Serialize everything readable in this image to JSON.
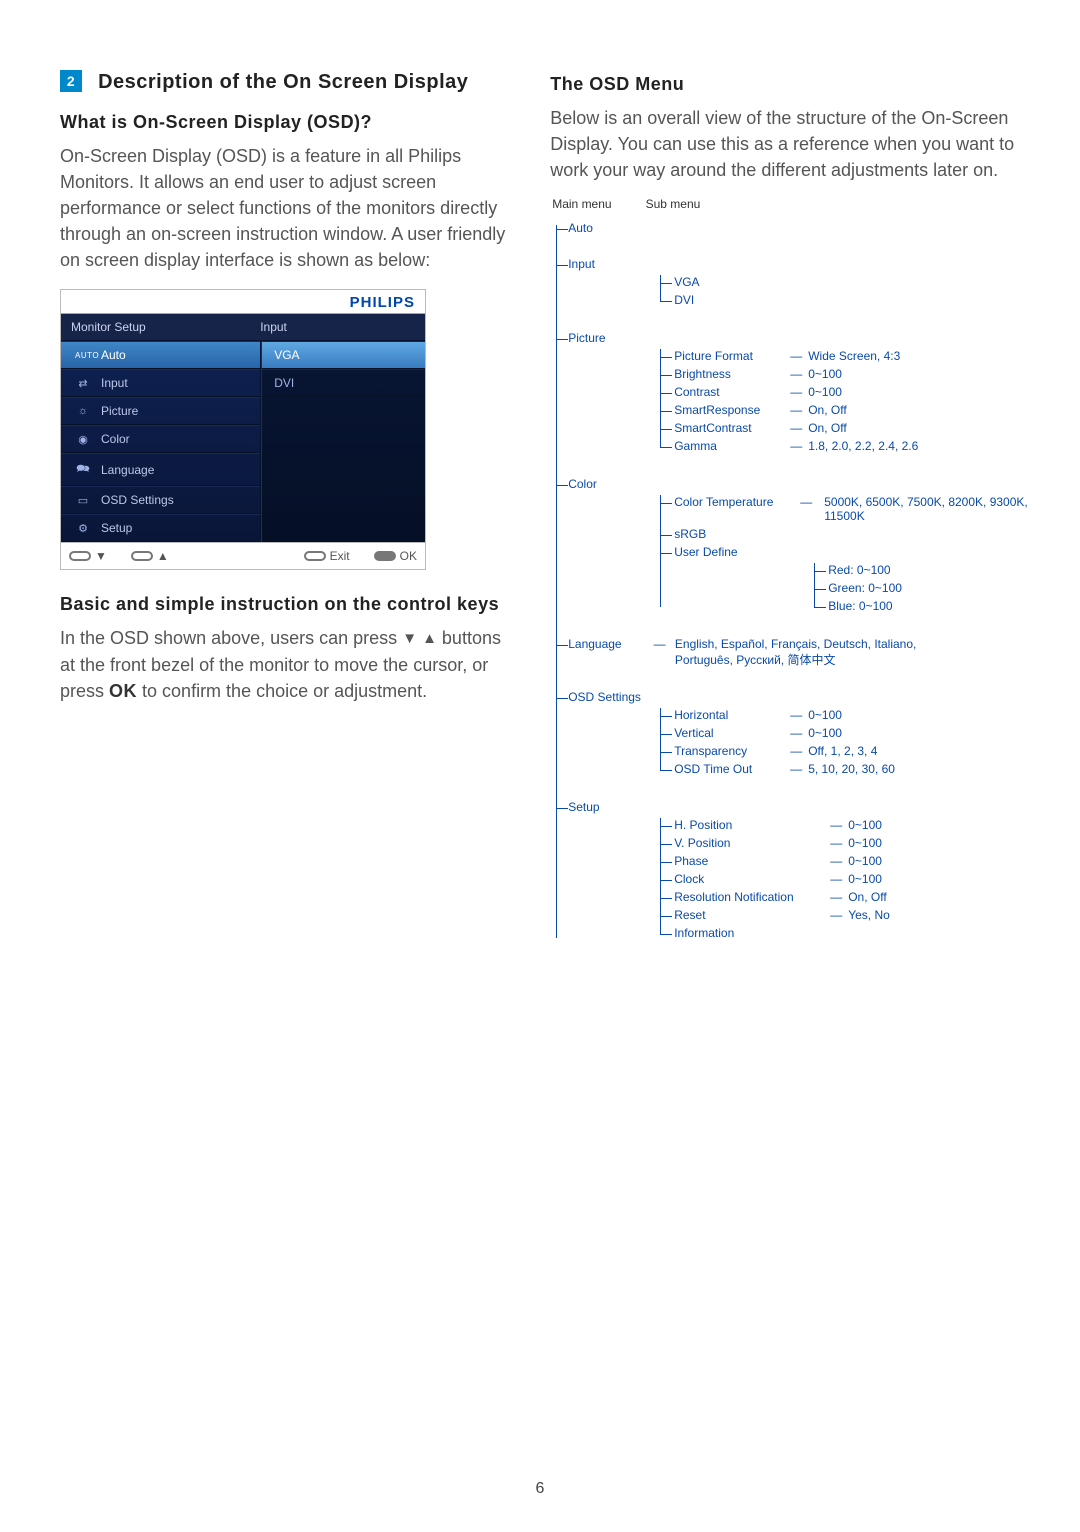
{
  "section": {
    "marker": "2",
    "title": "Description of the On Screen Display"
  },
  "left": {
    "h_whatis": "What is On-Screen Display (OSD)?",
    "p_whatis": "On-Screen Display (OSD) is a feature in all Philips Monitors. It allows an end user to adjust screen performance or select functions of the monitors directly through an on-screen instruction window. A user friendly on screen display interface is shown as below:",
    "h_basic": "Basic and simple instruction on the control keys",
    "p_basic_1": "In the OSD shown above, users can press ",
    "p_basic_2": " buttons at the front bezel of the monitor to move the cursor, or press ",
    "p_basic_ok": "OK",
    "p_basic_3": " to confirm the choice or adjustment."
  },
  "osd": {
    "logo": "PHILIPS",
    "header_left": "Monitor Setup",
    "header_right": "Input",
    "left_items": [
      {
        "icon": "AUTO",
        "label": "Auto",
        "active": true,
        "kind": "auto"
      },
      {
        "icon": "⇄",
        "label": "Input"
      },
      {
        "icon": "☼",
        "label": "Picture"
      },
      {
        "icon": "◉",
        "label": "Color"
      },
      {
        "icon": "🗪",
        "label": "Language"
      },
      {
        "icon": "▭",
        "label": "OSD Settings"
      },
      {
        "icon": "⚙",
        "label": "Setup"
      }
    ],
    "right_items": [
      {
        "label": "VGA",
        "hi": true
      },
      {
        "label": "DVI"
      }
    ],
    "bottom": {
      "down": "▼",
      "up": "▲",
      "exit": "Exit",
      "ok": "OK"
    }
  },
  "right": {
    "h": "The OSD Menu",
    "p": "Below is an overall view of the structure of the On-Screen Display. You can use this as a reference when you want to work your way around the different adjustments later on.",
    "tree_head_main": "Main menu",
    "tree_head_sub": "Sub menu"
  },
  "tree": {
    "auto": "Auto",
    "input": {
      "label": "Input",
      "items": [
        "VGA",
        "DVI"
      ]
    },
    "picture": {
      "label": "Picture",
      "items": [
        {
          "k": "Picture Format",
          "v": "Wide Screen, 4:3"
        },
        {
          "k": "Brightness",
          "v": "0~100"
        },
        {
          "k": "Contrast",
          "v": "0~100"
        },
        {
          "k": "SmartResponse",
          "v": "On, Off"
        },
        {
          "k": "SmartContrast",
          "v": "On, Off"
        },
        {
          "k": "Gamma",
          "v": "1.8, 2.0, 2.2, 2.4, 2.6"
        }
      ]
    },
    "color": {
      "label": "Color",
      "ct_k": "Color Temperature",
      "ct_v": "5000K, 6500K, 7500K, 8200K, 9300K, 11500K",
      "srgb": "sRGB",
      "ud": "User Define",
      "ud_items": [
        "Red: 0~100",
        "Green: 0~100",
        "Blue: 0~100"
      ]
    },
    "language": {
      "label": "Language",
      "value": "English, Español, Français, Deutsch, Italiano, Português, Русский, 简体中文"
    },
    "osd": {
      "label": "OSD Settings",
      "items": [
        {
          "k": "Horizontal",
          "v": "0~100"
        },
        {
          "k": "Vertical",
          "v": "0~100"
        },
        {
          "k": "Transparency",
          "v": "Off, 1, 2, 3, 4"
        },
        {
          "k": "OSD Time Out",
          "v": "5, 10, 20, 30, 60"
        }
      ]
    },
    "setup": {
      "label": "Setup",
      "items": [
        {
          "k": "H. Position",
          "v": "0~100"
        },
        {
          "k": "V. Position",
          "v": "0~100"
        },
        {
          "k": "Phase",
          "v": "0~100"
        },
        {
          "k": "Clock",
          "v": "0~100"
        },
        {
          "k": "Resolution Notification",
          "v": "On, Off"
        },
        {
          "k": "Reset",
          "v": "Yes, No"
        },
        {
          "k": "Information",
          "v": ""
        }
      ]
    }
  },
  "page_number": "6"
}
